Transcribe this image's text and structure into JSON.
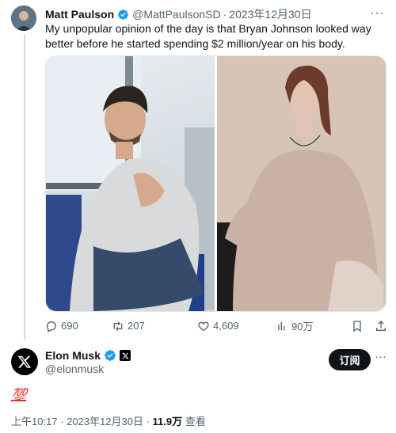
{
  "quoted_tweet": {
    "display_name": "Matt Paulson",
    "handle": "@MattPaulsonSD",
    "separator": "·",
    "date": "2023年12月30日",
    "text": "My unpopular opinion of the day is that Bryan Johnson looked way better before he started spending $2 million/year on his body.",
    "actions": {
      "replies": "690",
      "retweets": "207",
      "likes": "4,609",
      "views": "90万"
    }
  },
  "main_tweet": {
    "display_name": "Elon Musk",
    "handle": "@elonmusk",
    "follow_label": "订阅",
    "content": "💯",
    "timestamp": "上午10:17 · 2023年12月30日 · ",
    "views_count": "11.9万",
    "views_label": " 查看"
  },
  "colors": {
    "verified": "#1d9bf0",
    "text_primary": "#0f1419",
    "text_secondary": "#536471",
    "button_bg": "#0f1419"
  },
  "icons": {
    "reply": "speech-bubble-icon",
    "retweet": "retweet-arrows-icon",
    "like": "heart-icon",
    "views": "bar-chart-icon",
    "bookmark": "bookmark-icon",
    "share": "share-arrow-icon"
  }
}
